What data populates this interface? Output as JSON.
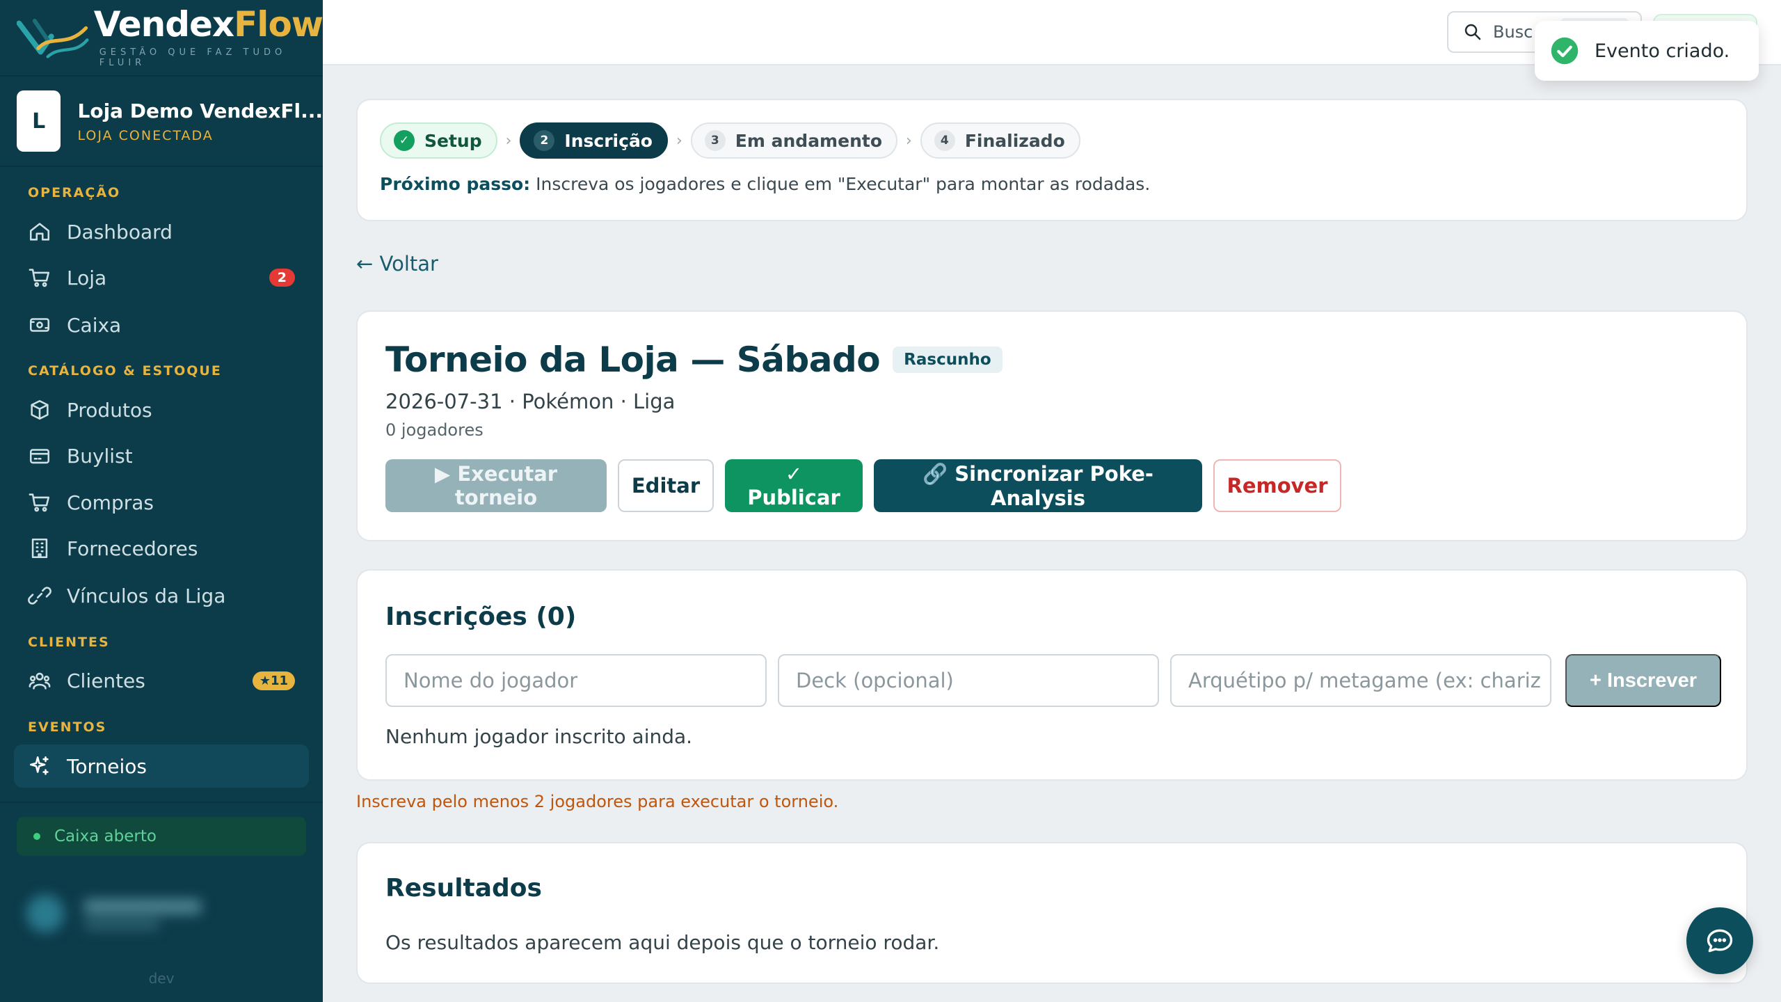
{
  "brand": {
    "name_part1": "Vendex",
    "name_part2": "Flow",
    "tagline": "GESTÃO QUE FAZ TUDO FLUIR"
  },
  "store": {
    "avatar": "L",
    "name": "Loja Demo VendexFl...",
    "status": "LOJA CONECTADA"
  },
  "nav": {
    "sections": [
      "OPERAÇÃO",
      "CATÁLOGO & ESTOQUE",
      "CLIENTES",
      "EVENTOS"
    ],
    "items": [
      {
        "label": "Dashboard",
        "icon": "home-icon"
      },
      {
        "label": "Loja",
        "icon": "cart-icon",
        "badge": "2"
      },
      {
        "label": "Caixa",
        "icon": "cash-register-icon"
      },
      {
        "label": "Produtos",
        "icon": "box-icon"
      },
      {
        "label": "Buylist",
        "icon": "wallet-icon"
      },
      {
        "label": "Compras",
        "icon": "cart-icon"
      },
      {
        "label": "Fornecedores",
        "icon": "building-icon"
      },
      {
        "label": "Vínculos da Liga",
        "icon": "link-icon"
      },
      {
        "label": "Clientes",
        "icon": "users-icon",
        "badge": "★11"
      },
      {
        "label": "Torneios",
        "icon": "sparkle-icon",
        "active": true
      }
    ]
  },
  "sidebar_footer": {
    "cash_status": "Caixa aberto",
    "env": "dev"
  },
  "topbar": {
    "search_text": "Busc"
  },
  "toast": {
    "message": "Evento criado."
  },
  "stepper": {
    "steps": [
      {
        "num": "✓",
        "label": "Setup",
        "state": "done"
      },
      {
        "num": "2",
        "label": "Inscrição",
        "state": "active"
      },
      {
        "num": "3",
        "label": "Em andamento",
        "state": "pending"
      },
      {
        "num": "4",
        "label": "Finalizado",
        "state": "pending"
      }
    ],
    "separator": "›",
    "next_label": "Próximo passo:",
    "next_text": " Inscreva os jogadores e clique em \"Executar\" para montar as rodadas."
  },
  "back_link": "← Voltar",
  "event": {
    "title": "Torneio da Loja — Sábado",
    "status": "Rascunho",
    "meta": "2026-07-31 · Pokémon · Liga",
    "players": "0 jogadores",
    "actions": {
      "execute": "▶ Executar torneio",
      "edit": "Editar",
      "publish": "✓ Publicar",
      "sync": "🔗 Sincronizar Poke-Analysis",
      "remove": "Remover"
    }
  },
  "registrations": {
    "title": "Inscrições (0)",
    "player_placeholder": "Nome do jogador",
    "deck_placeholder": "Deck (opcional)",
    "archetype_placeholder": "Arquétipo p/ metagame (ex: chariz",
    "submit": "+ Inscrever",
    "empty": "Nenhum jogador inscrito ainda."
  },
  "warning": "Inscreva pelo menos 2 jogadores para executar o torneio.",
  "results": {
    "title": "Resultados",
    "empty": "Os resultados aparecem aqui depois que o torneio rodar."
  },
  "colors": {
    "sidebar": "#0c3b4a",
    "accent_gold": "#e8b440",
    "success": "#0e9460",
    "danger": "#c62828"
  }
}
